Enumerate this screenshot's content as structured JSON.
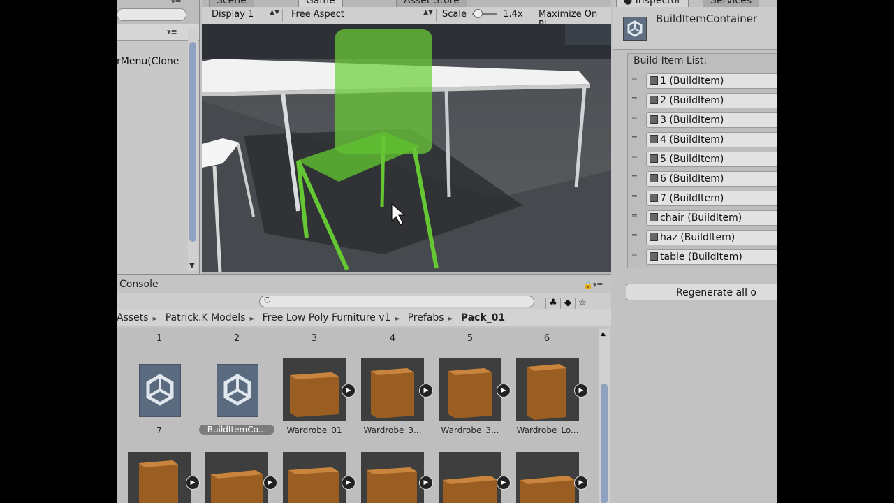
{
  "hierarchy": {
    "item_text": "rMenu(Clone"
  },
  "game_view": {
    "tabs": [
      "Scene",
      "Game",
      "Asset Store"
    ],
    "display": "Display 1",
    "aspect": "Free Aspect",
    "scale_label": "Scale",
    "scale_value": "1.4x",
    "maximize": "Maximize On Pl"
  },
  "console": {
    "title": "Console",
    "breadcrumb": [
      "Assets",
      "Patrick.K Models",
      "Free Low Poly Furniture v1",
      "Prefabs"
    ],
    "breadcrumb_current": "Pack_01",
    "row1_numbers": [
      "1",
      "2",
      "3",
      "4",
      "5",
      "6"
    ],
    "row2_labels": [
      "7",
      "BuildItemCo...",
      "Wardrobe_01",
      "Wardrobe_3...",
      "Wardrobe_3...",
      "Wardrobe_Lo..."
    ]
  },
  "inspector": {
    "tabs": [
      "Inspector",
      "Services"
    ],
    "object_name": "BuildItemContainer",
    "list_label": "Build Item List:",
    "items": [
      "1 (BuildItem)",
      "2 (BuildItem)",
      "3 (BuildItem)",
      "4 (BuildItem)",
      "5 (BuildItem)",
      "6 (BuildItem)",
      "7 (BuildItem)",
      "chair (BuildItem)",
      "haz (BuildItem)",
      "table (BuildItem)"
    ],
    "regenerate": "Regenerate all o"
  },
  "colors": {
    "chair": "#6ccf3a",
    "selection": "#7c7c7c",
    "scroll_thumb": "#8fa3c0"
  }
}
